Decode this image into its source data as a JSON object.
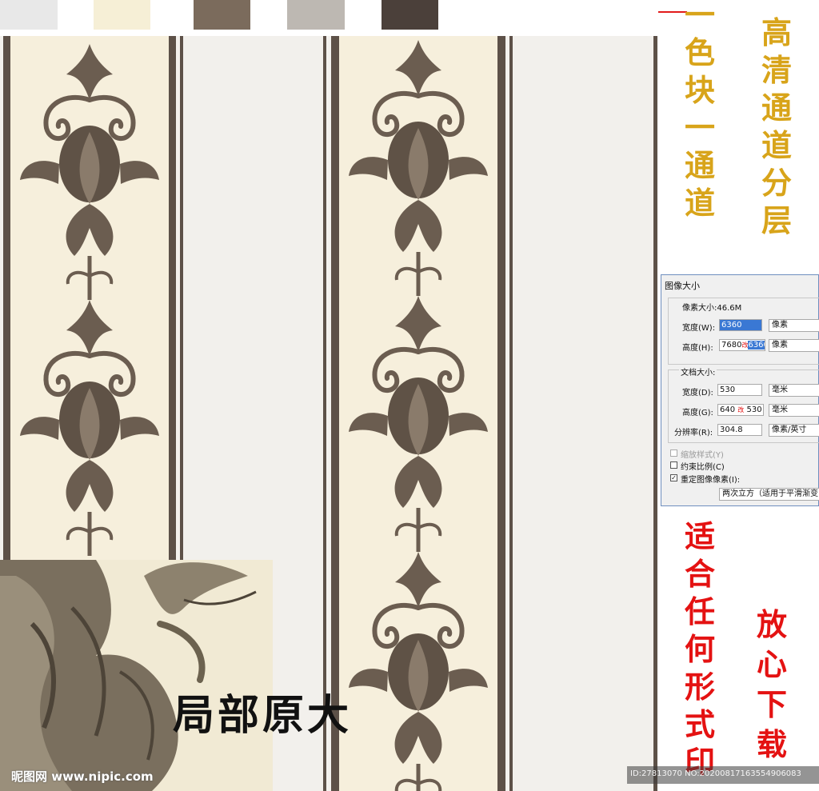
{
  "swatches": [
    {
      "name": "swatch-light-gray",
      "color": "#e8e8e8"
    },
    {
      "name": "swatch-cream",
      "color": "#f6efd6"
    },
    {
      "name": "swatch-taupe",
      "color": "#7b6b5c"
    },
    {
      "name": "swatch-silver",
      "color": "#bdb8b2"
    },
    {
      "name": "swatch-dark-brown",
      "color": "#4b403a"
    }
  ],
  "texts": {
    "one_color_one_channel": [
      "一",
      "色",
      "块",
      "一",
      "通",
      "道"
    ],
    "hd_channel_layers": [
      "高",
      "清",
      "通",
      "道",
      "分",
      "层"
    ],
    "fit_any_print": [
      "适",
      "合",
      "任",
      "何",
      "形",
      "式",
      "印"
    ],
    "download_freely": [
      "放",
      "心",
      "下",
      "载"
    ],
    "local_original_size": "局部原大"
  },
  "dialog": {
    "title": "图像大小",
    "pixel_dimensions": "像素大小:46.6M",
    "width_label": "宽度(W):",
    "width_value": "6360",
    "width_unit": "像素",
    "height_label": "高度(H):",
    "height_old": "7680",
    "height_mark": "改",
    "height_value": "6360",
    "height_unit": "像素",
    "doc_size": "文档大小:",
    "doc_width_label": "宽度(D):",
    "doc_width_value": "530",
    "doc_width_unit": "毫米",
    "doc_height_label": "高度(G):",
    "doc_height_old": "640",
    "doc_height_mark": "改",
    "doc_height_value": "530",
    "doc_height_unit": "毫米",
    "resolution_label": "分辨率(R):",
    "resolution_value": "304.8",
    "resolution_unit": "像素/英寸",
    "scale_styles": "缩放样式(Y)",
    "constrain": "约束比例(C)",
    "resample": "重定图像像素(I):",
    "resample_method": "两次立方（适用于平滑渐变"
  },
  "watermarks": {
    "site": "昵图网 www.nipic.com",
    "id_line": "ID:27813070 NO:20200817163554906083"
  }
}
